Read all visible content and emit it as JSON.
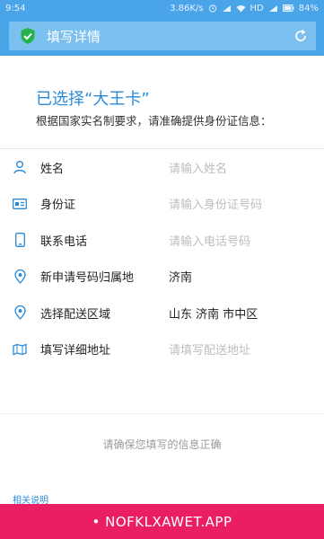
{
  "status": {
    "time": "9:54",
    "speed": "3.86K/s",
    "network": "HD",
    "battery": "84%"
  },
  "header": {
    "title": "填写详情"
  },
  "intro": {
    "selected": "已选择“大王卡”",
    "hint": "根据国家实名制要求，请准确提供身份证信息："
  },
  "form": {
    "name": {
      "label": "姓名",
      "placeholder": "请输入姓名"
    },
    "idcard": {
      "label": "身份证",
      "placeholder": "请输入身份证号码"
    },
    "phone": {
      "label": "联系电话",
      "placeholder": "请输入电话号码"
    },
    "region": {
      "label": "新申请号码归属地",
      "value": "济南"
    },
    "delivery": {
      "label": "选择配送区域",
      "value": "山东 济南 市中区"
    },
    "address": {
      "label": "填写详细地址",
      "placeholder": "请填写配送地址"
    }
  },
  "notice": "请确保您填写的信息正确",
  "related": "相关说明",
  "footer": "• NOFKLXAWET.APP",
  "colors": {
    "primary": "#4aa4e8",
    "accent": "#2b8ad8",
    "footer": "#e91e63"
  }
}
